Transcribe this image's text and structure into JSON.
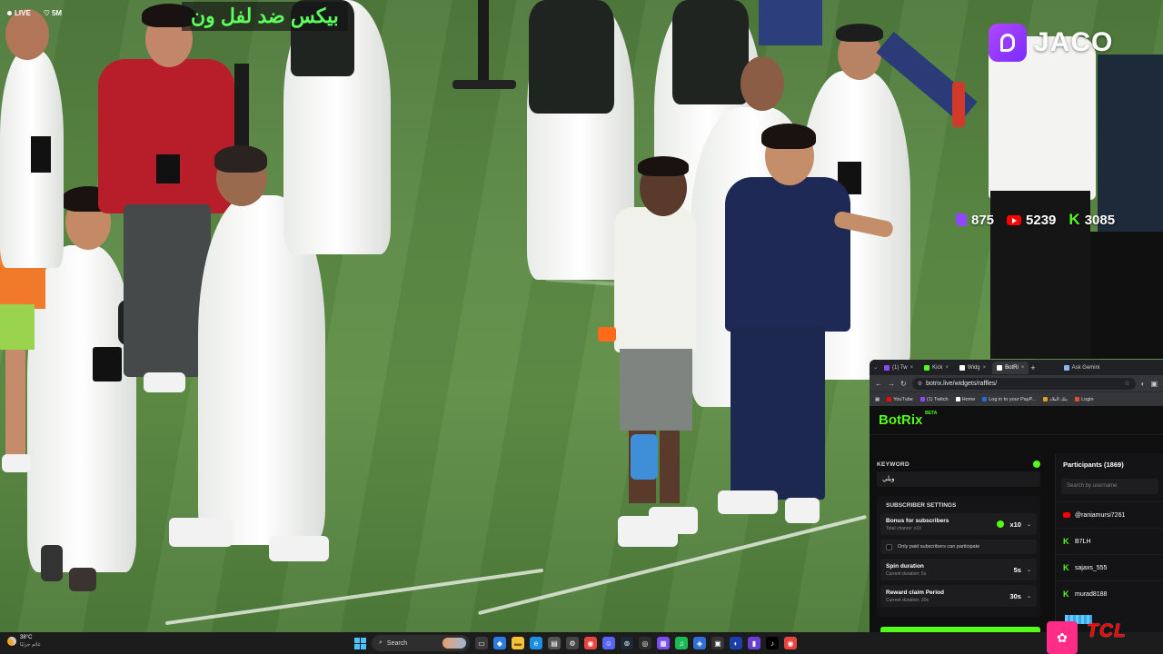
{
  "stream": {
    "live_label": "LIVE",
    "viewers": "5M",
    "title_banner": "بيكس ضد لفل ون",
    "brand_name": "JACO",
    "stats": {
      "twitch": "875",
      "youtube": "5239",
      "kick": "3085"
    }
  },
  "browser": {
    "tabs": [
      {
        "label": "(1) Tw",
        "color": "#9146ff",
        "active": false
      },
      {
        "label": "Kick",
        "color": "#53fc18",
        "active": false
      },
      {
        "label": "Widg",
        "color": "#ffffff",
        "active": false
      },
      {
        "label": "BotRi",
        "color": "#ffffff",
        "active": true
      },
      {
        "label": "Ask Gemini",
        "color": "#8ab4f8",
        "active": false
      }
    ],
    "url": "botrix.live/widgets/raffles/",
    "bookmarks": [
      {
        "label": "YouTube",
        "color": "#ff0000"
      },
      {
        "label": "(1) Twitch",
        "color": "#9146ff"
      },
      {
        "label": "Home",
        "color": "#ffffff"
      },
      {
        "label": "Log in to your PayP...",
        "color": "#1f6fd1"
      },
      {
        "label": "بنك البلاد",
        "color": "#e0a020"
      },
      {
        "label": "Login",
        "color": "#e34d2e"
      }
    ]
  },
  "botrix": {
    "logo": "BotRix",
    "beta": "BETA",
    "keyword_label": "KEYWORD",
    "keyword_value": "ويلي",
    "subscriber_settings_label": "SUBSCRIBER SETTINGS",
    "bonus": {
      "name": "Bonus for subscribers",
      "sub": "Total chance: x10",
      "value": "x10"
    },
    "paid_only_label": "Only paid subscribers can participate",
    "spin": {
      "name": "Spin duration",
      "sub": "Current duration: 5s",
      "value": "5s"
    },
    "claim": {
      "name": "Reward claim Period",
      "sub": "Current duration: 30s",
      "value": "30s"
    },
    "participants_label": "Participants (1869)",
    "search_placeholder": "Search by username",
    "participants": [
      {
        "name": "@raniamursi7261",
        "platform": "youtube"
      },
      {
        "name": "B7LH",
        "platform": "kick"
      },
      {
        "name": "sajaxs_555",
        "platform": "kick"
      },
      {
        "name": "murad8188",
        "platform": "kick"
      }
    ]
  },
  "taskbar": {
    "temperature": "38°C",
    "weather_sub": "غائم جزئيًا",
    "search_label": "Search",
    "corner_brand": "TCL"
  },
  "colors": {
    "kick_green": "#53fc18",
    "twitch_purple": "#9146ff",
    "youtube_red": "#ff0000",
    "title_green": "#5dff5d"
  }
}
